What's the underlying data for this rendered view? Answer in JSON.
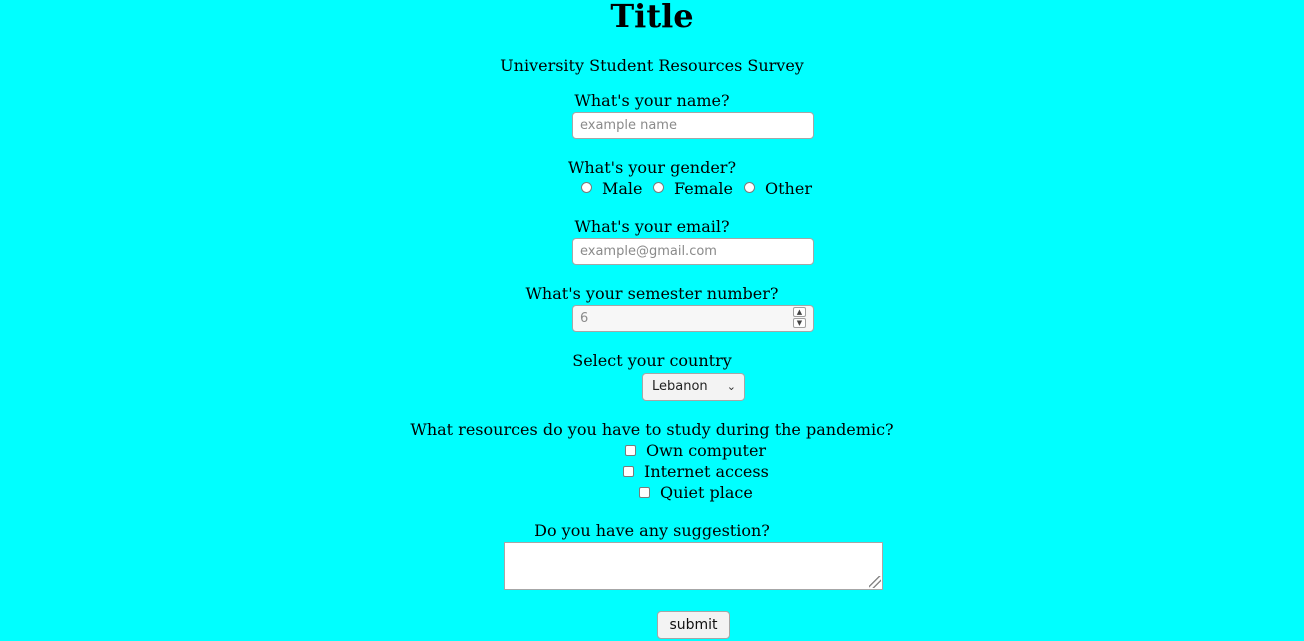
{
  "page": {
    "title": "Title",
    "subtitle": "University Student Resources Survey",
    "background_color": "#00ffff"
  },
  "form": {
    "name": {
      "label": "What's your name?",
      "placeholder": "example name",
      "value": ""
    },
    "gender": {
      "label": "What's your gender?",
      "options": [
        "Male",
        "Female",
        "Other"
      ],
      "selected": ""
    },
    "email": {
      "label": "What's your email?",
      "placeholder": "example@gmail.com",
      "value": ""
    },
    "semester": {
      "label": "What's your semester number?",
      "placeholder": "6",
      "value": "",
      "spinner_icon_up": "chevron-up-icon",
      "spinner_icon_down": "chevron-down-icon"
    },
    "country": {
      "label": "Select your country",
      "selected": "Lebanon",
      "chevron_icon": "chevron-down-icon"
    },
    "resources": {
      "label": "What resources do you have to study during the pandemic?",
      "options": [
        "Own computer",
        "Internet access",
        "Quiet place"
      ],
      "checked": []
    },
    "suggestion": {
      "label": "Do you have any suggestion?",
      "value": ""
    },
    "submit_label": "submit"
  }
}
